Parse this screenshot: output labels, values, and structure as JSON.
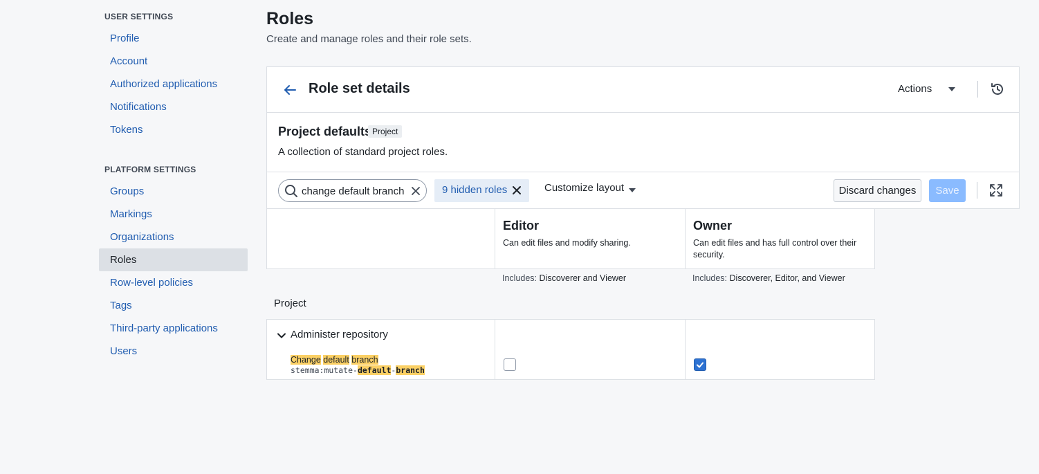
{
  "sidebar": {
    "user_heading": "USER SETTINGS",
    "user_items": [
      {
        "label": "Profile"
      },
      {
        "label": "Account"
      },
      {
        "label": "Authorized applications"
      },
      {
        "label": "Notifications"
      },
      {
        "label": "Tokens"
      }
    ],
    "platform_heading": "PLATFORM SETTINGS",
    "platform_items": [
      {
        "label": "Groups"
      },
      {
        "label": "Markings"
      },
      {
        "label": "Organizations"
      },
      {
        "label": "Roles",
        "active": true
      },
      {
        "label": "Row-level policies"
      },
      {
        "label": "Tags"
      },
      {
        "label": "Third-party applications"
      },
      {
        "label": "Users"
      }
    ]
  },
  "page": {
    "title": "Roles",
    "subtitle": "Create and manage roles and their role sets."
  },
  "card": {
    "title": "Role set details",
    "actions_label": "Actions",
    "role_set": {
      "name": "Project defaults",
      "tag": "Project",
      "description": "A collection of standard project roles."
    }
  },
  "toolbar": {
    "search_value": "change default branch",
    "hidden_roles_label": "9 hidden roles",
    "customize_label": "Customize layout",
    "discard_label": "Discard changes",
    "save_label": "Save"
  },
  "roles": [
    {
      "name": "Editor",
      "description": "Can edit files and modify sharing.",
      "includes_label": "Includes:",
      "includes": "Discoverer and Viewer"
    },
    {
      "name": "Owner",
      "description": "Can edit files and has full control over their security.",
      "includes_label": "Includes:",
      "includes": "Discoverer, Editor, and Viewer"
    }
  ],
  "permissions": {
    "group_label": "Project",
    "category": "Administer repository",
    "item": {
      "name_parts": [
        "Change",
        "default",
        "branch"
      ],
      "id_parts": [
        "stemma:mutate-",
        "default",
        "-",
        "branch"
      ],
      "editor_checked": false,
      "owner_checked": true
    }
  },
  "colors": {
    "accent": "#2d72d2",
    "link": "#215db0",
    "highlight": "#fbd065",
    "active_nav": "#dce0e5"
  }
}
